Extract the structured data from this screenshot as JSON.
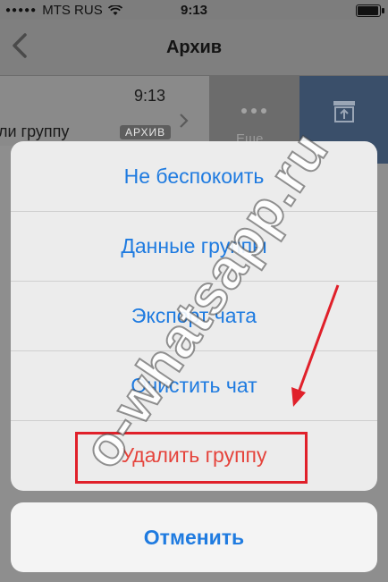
{
  "status_bar": {
    "carrier": "MTS RUS",
    "time": "9:13",
    "battery_level": 0.9
  },
  "nav": {
    "title": "Архив"
  },
  "chat_row": {
    "time": "9:13",
    "preview": "ли группу",
    "badge": "АРХИВ"
  },
  "swipe_actions": {
    "more_label": "Еще"
  },
  "action_sheet": {
    "options": [
      {
        "label": "Не беспокоить"
      },
      {
        "label": "Данные группы"
      },
      {
        "label": "Экспорт чата"
      },
      {
        "label": "Очистить чат"
      },
      {
        "label": "Удалить группу"
      }
    ],
    "cancel_label": "Отменить"
  },
  "watermark": "o-whatsapp.ru",
  "colors": {
    "action_blue": "#1f7be0",
    "destructive_red": "#e5443c",
    "annotation_red": "#e0202a"
  }
}
